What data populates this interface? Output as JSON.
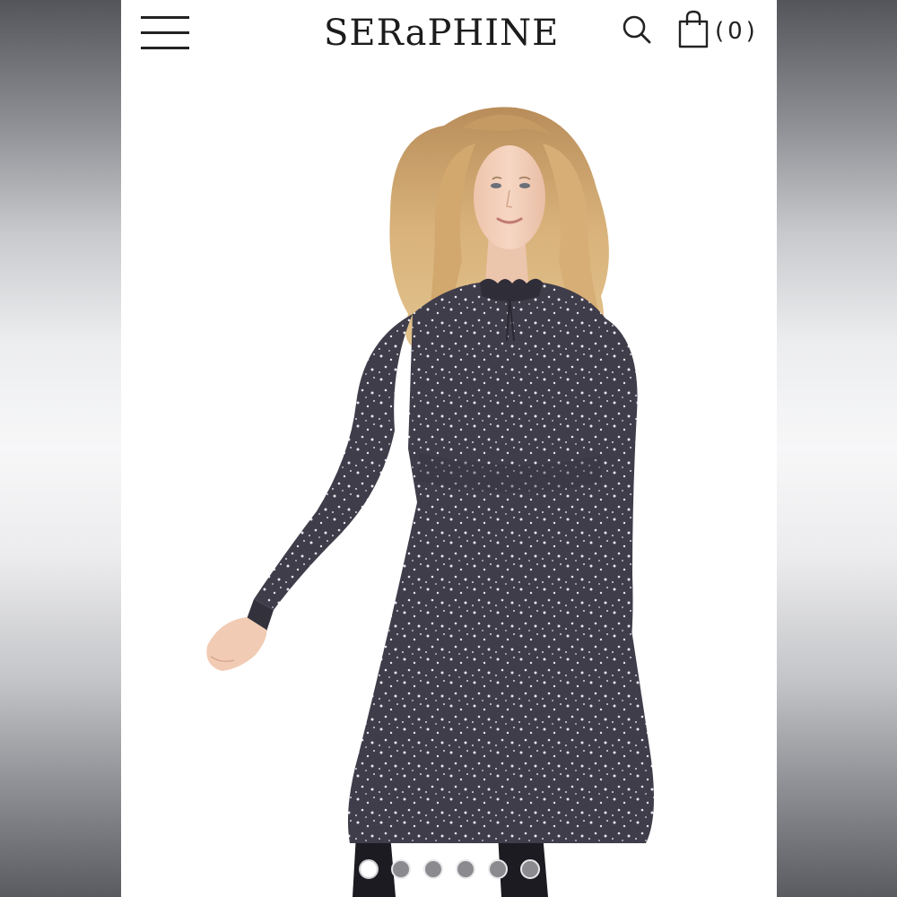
{
  "header": {
    "brand": "SERaPHINE",
    "cart_count": "(0)"
  },
  "icons": {
    "menu": "hamburger-menu-icon",
    "search": "search-icon",
    "cart": "shopping-bag-icon"
  },
  "gallery": {
    "slide_count": 6,
    "active_index": 0
  },
  "colors": {
    "dress": "#3f3d4a",
    "hair": "#c9a06a",
    "skin": "#f1cdb7",
    "background": "#ffffff"
  }
}
